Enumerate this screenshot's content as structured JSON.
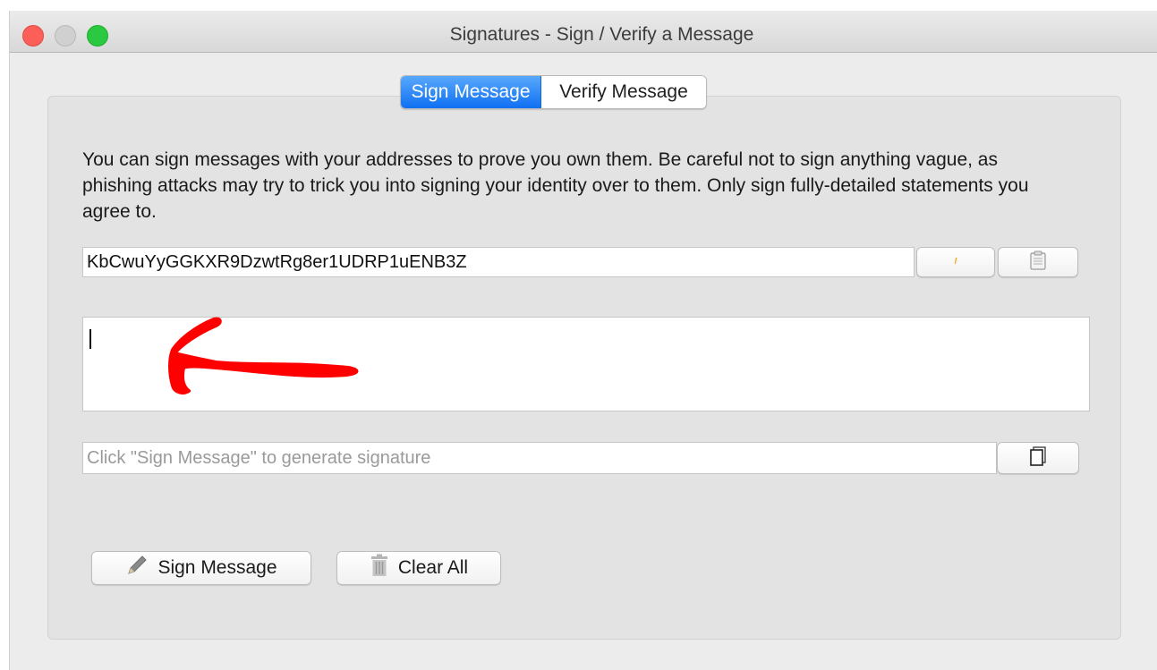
{
  "window": {
    "title": "Signatures - Sign / Verify a Message"
  },
  "tabs": [
    {
      "label": "Sign Message",
      "active": true
    },
    {
      "label": "Verify Message",
      "active": false
    }
  ],
  "description": "You can sign messages with your addresses to prove you own them. Be careful not to sign anything vague, as phishing attacks may try to trick you into signing your identity over to them. Only sign fully-detailed statements you agree to.",
  "address_field": {
    "value": "KbCwuYyGGKXR9DzwtRg8er1UDRP1uENB3Z",
    "address_book_icon": "address-book-icon",
    "paste_icon": "clipboard-icon"
  },
  "message_field": {
    "value": ""
  },
  "signature_field": {
    "value": "",
    "placeholder": "Click \"Sign Message\" to generate signature",
    "copy_icon": "copy-icon"
  },
  "actions": {
    "sign_label": "Sign Message",
    "clear_label": "Clear All"
  },
  "colors": {
    "active_tab": "#1a7cf5",
    "annotation_arrow": "#ff0000"
  }
}
